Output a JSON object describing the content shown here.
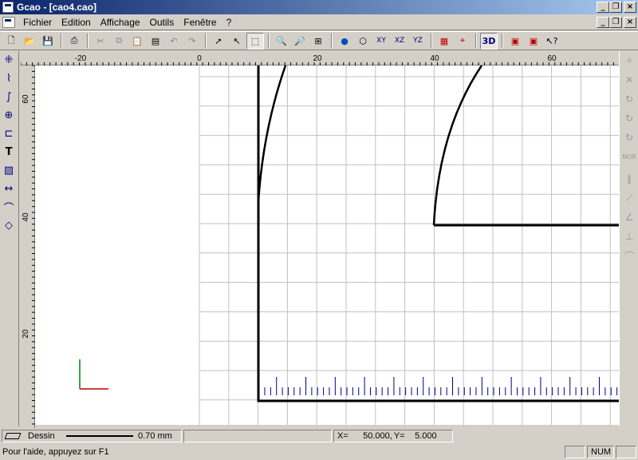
{
  "window": {
    "title": "Gcao - [cao4.cao]"
  },
  "menu": {
    "items": [
      "Fichier",
      "Edition",
      "Affichage",
      "Outils",
      "Fenêtre",
      "?"
    ]
  },
  "toolbar": {
    "view_3d_label": "3D"
  },
  "ruler": {
    "top_labels": [
      "-20",
      "0",
      "20",
      "40",
      "60"
    ],
    "left_labels": [
      "60",
      "40",
      "20"
    ]
  },
  "status": {
    "layer_name": "Dessin",
    "line_width": "0.70 mm",
    "x_label": "X=",
    "x_value": "50.000",
    "y_label": "Y=",
    "y_value": "5.000",
    "help_text": "Pour l'aide, appuyez sur F1",
    "num_indicator": "NUM"
  },
  "colors": {
    "titlebar_start": "#0a246a",
    "titlebar_end": "#a6caf0",
    "axis_x": "#c00000",
    "axis_y": "#008000",
    "grid": "#c0c0c0",
    "ticks": "#000080"
  }
}
